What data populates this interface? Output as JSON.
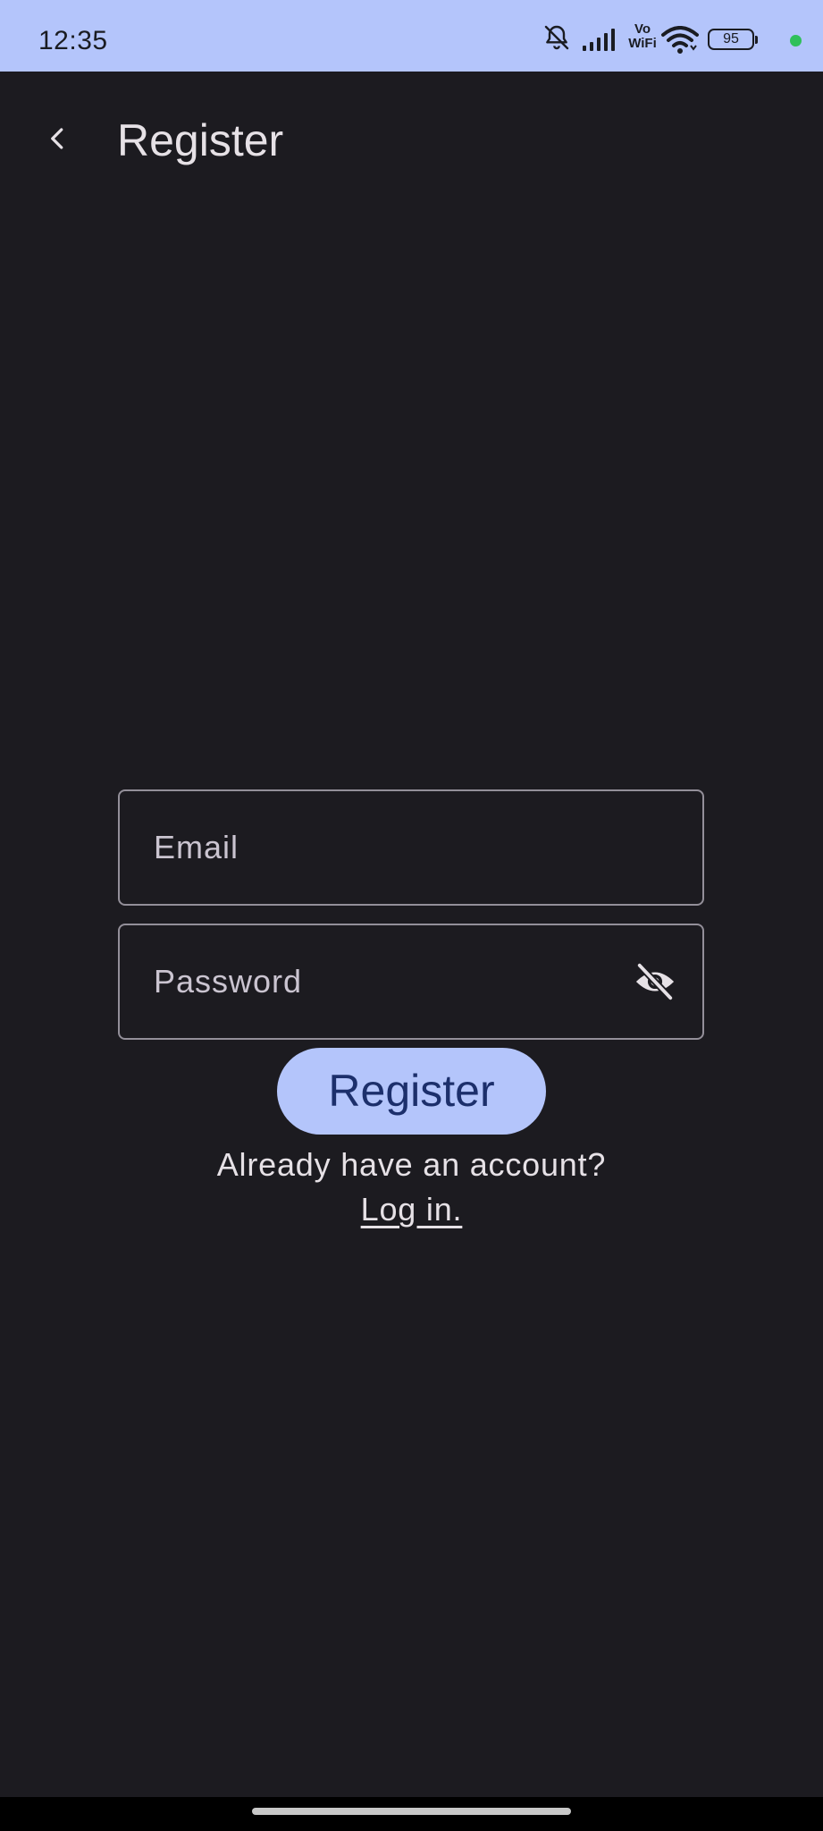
{
  "status_bar": {
    "time": "12:35",
    "network_label_top": "Vo",
    "network_label_bottom": "WiFi",
    "battery_level": "95",
    "icons": [
      "bell-off-icon",
      "signal-icon",
      "vowifi-icon",
      "wifi-icon",
      "battery-icon",
      "privacy-dot"
    ]
  },
  "app_bar": {
    "back_icon": "chevron-left-icon",
    "title": "Register"
  },
  "form": {
    "email": {
      "placeholder": "Email",
      "value": ""
    },
    "password": {
      "placeholder": "Password",
      "value": "",
      "visibility_icon": "eye-off-icon"
    },
    "submit_label": "Register"
  },
  "footer": {
    "prompt": "Already have an account?",
    "link_label": "Log in."
  },
  "colors": {
    "status_bar_bg": "#b4c5fb",
    "background": "#1c1b20",
    "primary_button_bg": "#b4c5fb",
    "primary_button_text": "#1c2f6b",
    "text": "#e6e1e6",
    "outline": "#938f99",
    "privacy_dot": "#2fc05a"
  }
}
